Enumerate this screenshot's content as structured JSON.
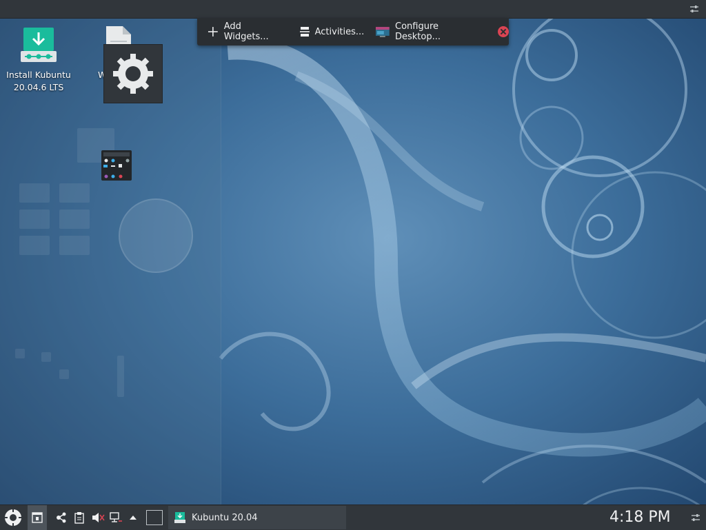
{
  "toolbox": {
    "add_widgets_label": "Add Widgets...",
    "activities_label": "Activities...",
    "configure_desktop_label": "Configure Desktop..."
  },
  "desktop": {
    "icons": [
      {
        "label_line1": "Install Kubuntu",
        "label_line2": "20.04.6 LTS",
        "icon": "install-download-icon"
      },
      {
        "label": "W",
        "icon": "document-icon"
      }
    ]
  },
  "panel": {
    "task_label": "Kubuntu 20.04",
    "clock": "4:18 PM"
  },
  "colors": {
    "panel_bg": "#31363b",
    "accent": "#1abc9c",
    "close_red": "#da4453"
  }
}
